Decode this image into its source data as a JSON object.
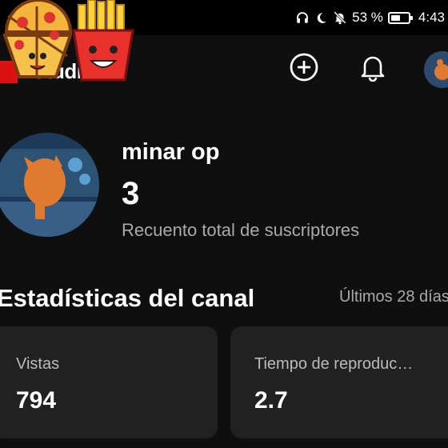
{
  "status_bar": {
    "battery_percent": "53 %",
    "battery_level": 0.53,
    "time": "4:43",
    "icons": [
      "headphones-icon",
      "moon-icon",
      "bell-off-icon",
      "battery-icon"
    ]
  },
  "app_bar": {
    "logo_text": "Studio",
    "icons": [
      "create-icon",
      "notifications-icon",
      "account-avatar"
    ]
  },
  "channel": {
    "name": "minar op",
    "subscriber_count": "3",
    "subscriber_label": "Recuento total de suscriptores"
  },
  "analytics": {
    "title": "Estadísticas del canal",
    "range": "Últimos 28 días",
    "cards": [
      {
        "label": "Vistas",
        "value": "794"
      },
      {
        "label": "Tiempo de reproduc…",
        "value": "2.7"
      }
    ]
  },
  "colors": {
    "background": "#0f0f0f",
    "card": "#212121",
    "secondary_text": "#aaaaaa"
  }
}
